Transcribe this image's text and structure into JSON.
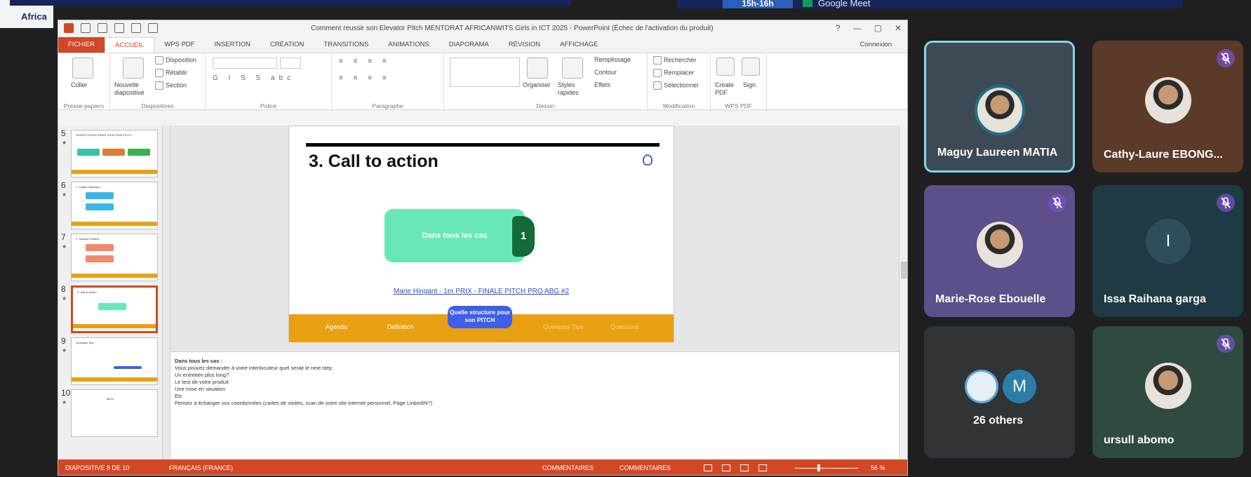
{
  "website": {
    "partial_label": "Africa",
    "time_badge": "15h-16h",
    "meet_badge": "Google Meet"
  },
  "powerpoint": {
    "window_title": "Comment reussir son Elevator Pitch MENTORAT AFRICANWITS Girls in ICT 2025 - PowerPoint (Échec de l'activation du produit)",
    "window_controls": [
      "?",
      "—",
      "▢",
      "✕"
    ],
    "tabs": [
      "FICHIER",
      "ACCUEIL",
      "WPS PDF",
      "INSERTION",
      "CRÉATION",
      "TRANSITIONS",
      "ANIMATIONS",
      "DIAPORAMA",
      "RÉVISION",
      "AFFICHAGE"
    ],
    "active_tab": "ACCUEIL",
    "connexion": "Connexion",
    "ribbon": {
      "groups": [
        {
          "label": "Presse-papiers",
          "buttons": [
            "Coller"
          ]
        },
        {
          "label": "Diapositives",
          "buttons": [
            "Nouvelle diapositive",
            "Disposition",
            "Rétablir",
            "Section"
          ]
        },
        {
          "label": "Police",
          "buttons": []
        },
        {
          "label": "Paragraphe",
          "buttons": []
        },
        {
          "label": "Dessin",
          "buttons": [
            "Organiser",
            "Styles rapides",
            "Remplissage",
            "Contour",
            "Effets"
          ]
        },
        {
          "label": "Modification",
          "buttons": [
            "Rechercher",
            "Remplacer",
            "Sélectionner"
          ]
        },
        {
          "label": "WPS PDF",
          "buttons": [
            "Create PDF",
            "Sign"
          ]
        }
      ]
    },
    "thumbnails": [
      {
        "num": "5",
        "title": "DIVERS STRUCTURES POUR SON PITCH"
      },
      {
        "num": "6",
        "title": "1. Capter l'attention"
      },
      {
        "num": "7",
        "title": "2. Susciter l'intérêt"
      },
      {
        "num": "8",
        "title": "3. Call to action"
      },
      {
        "num": "9",
        "title": "Quelques Tips"
      },
      {
        "num": "10",
        "title": "Merci"
      }
    ],
    "selected_slide": "8",
    "slide": {
      "heading": "3. Call to action",
      "card_text": "Dans tous les cas",
      "card_number": "1",
      "link": "Marie Hingant - 1er PRIX - FINALE PITCH PRO ABG #2",
      "bottom_nav": [
        "Agenda",
        "Définition",
        "Quelques Tips",
        "Questions"
      ],
      "active_pill": "Quelle structure pour son PITCH"
    },
    "notes": {
      "heading": "Dans tous les cas :",
      "lines": [
        "Vous pouvez demander à votre interlocuteur quel serait le next step",
        "Un entretien plus long?",
        "Le test de votre produit",
        "Une mise en situation",
        "Etc",
        "Pensez à échanger vos coordonnées (cartes de visites, scan de votre site internet personnel, Page LinkedIN?)"
      ]
    },
    "status": {
      "slide_count": "DIAPOSITIVE 8 DE 10",
      "language": "FRANÇAIS (FRANCE)",
      "comments1": "COMMENTAIRES",
      "comments2": "COMMENTAIRES",
      "zoom": "56 %"
    }
  },
  "meet": {
    "participants": [
      {
        "name": "Maguy Laureen MATIA",
        "muted": false,
        "active_speaker": true,
        "bg": "#3b4a55"
      },
      {
        "name": "Cathy-Laure EBONG...",
        "muted": true,
        "active_speaker": false,
        "bg": "#5b3a29"
      },
      {
        "name": "Marie-Rose Ebouelle",
        "muted": true,
        "active_speaker": false,
        "bg": "#5c4f8a"
      },
      {
        "name": "Issa Raihana garga",
        "muted": true,
        "active_speaker": false,
        "bg": "#1e3a44",
        "initial": "I"
      },
      {
        "name": "26 others",
        "muted": false,
        "active_speaker": false,
        "bg": "#303436",
        "initial": "M"
      },
      {
        "name": "ursull abomo",
        "muted": true,
        "active_speaker": false,
        "bg": "#2f4a3f"
      }
    ]
  },
  "colors": {
    "ppt_accent": "#d24726",
    "slide_orange": "#e9a113",
    "slide_green": "#68e8b7",
    "meet_active_border": "#8ad2ec"
  }
}
